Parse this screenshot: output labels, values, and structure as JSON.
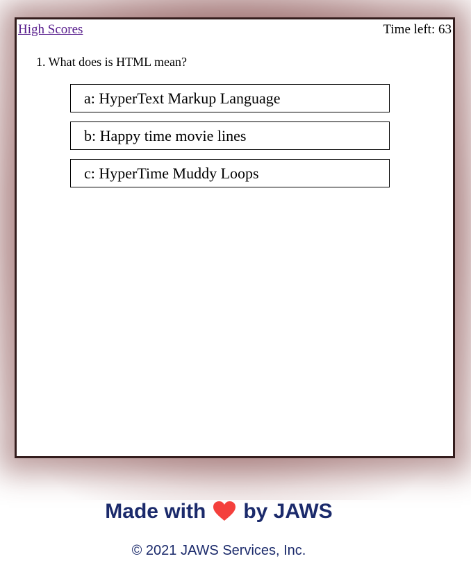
{
  "header": {
    "high_scores_label": "High Scores",
    "timer_label": "Time left:",
    "timer_value": "63"
  },
  "quiz": {
    "question": "1. What does is HTML mean?",
    "answers": [
      {
        "label": "a: HyperText Markup Language"
      },
      {
        "label": "b: Happy time movie lines"
      },
      {
        "label": "c: HyperTime Muddy Loops"
      }
    ]
  },
  "footer": {
    "made_with": "Made with",
    "by": "by JAWS",
    "heart_icon": "heart-icon",
    "heart_color": "#f4403c",
    "copyright": "© 2021 JAWS Services, Inc."
  },
  "colors": {
    "panel_border": "#341d1d",
    "glow": "#8a4a4a",
    "footer_text": "#1b2a6b",
    "link": "#551a8b"
  }
}
